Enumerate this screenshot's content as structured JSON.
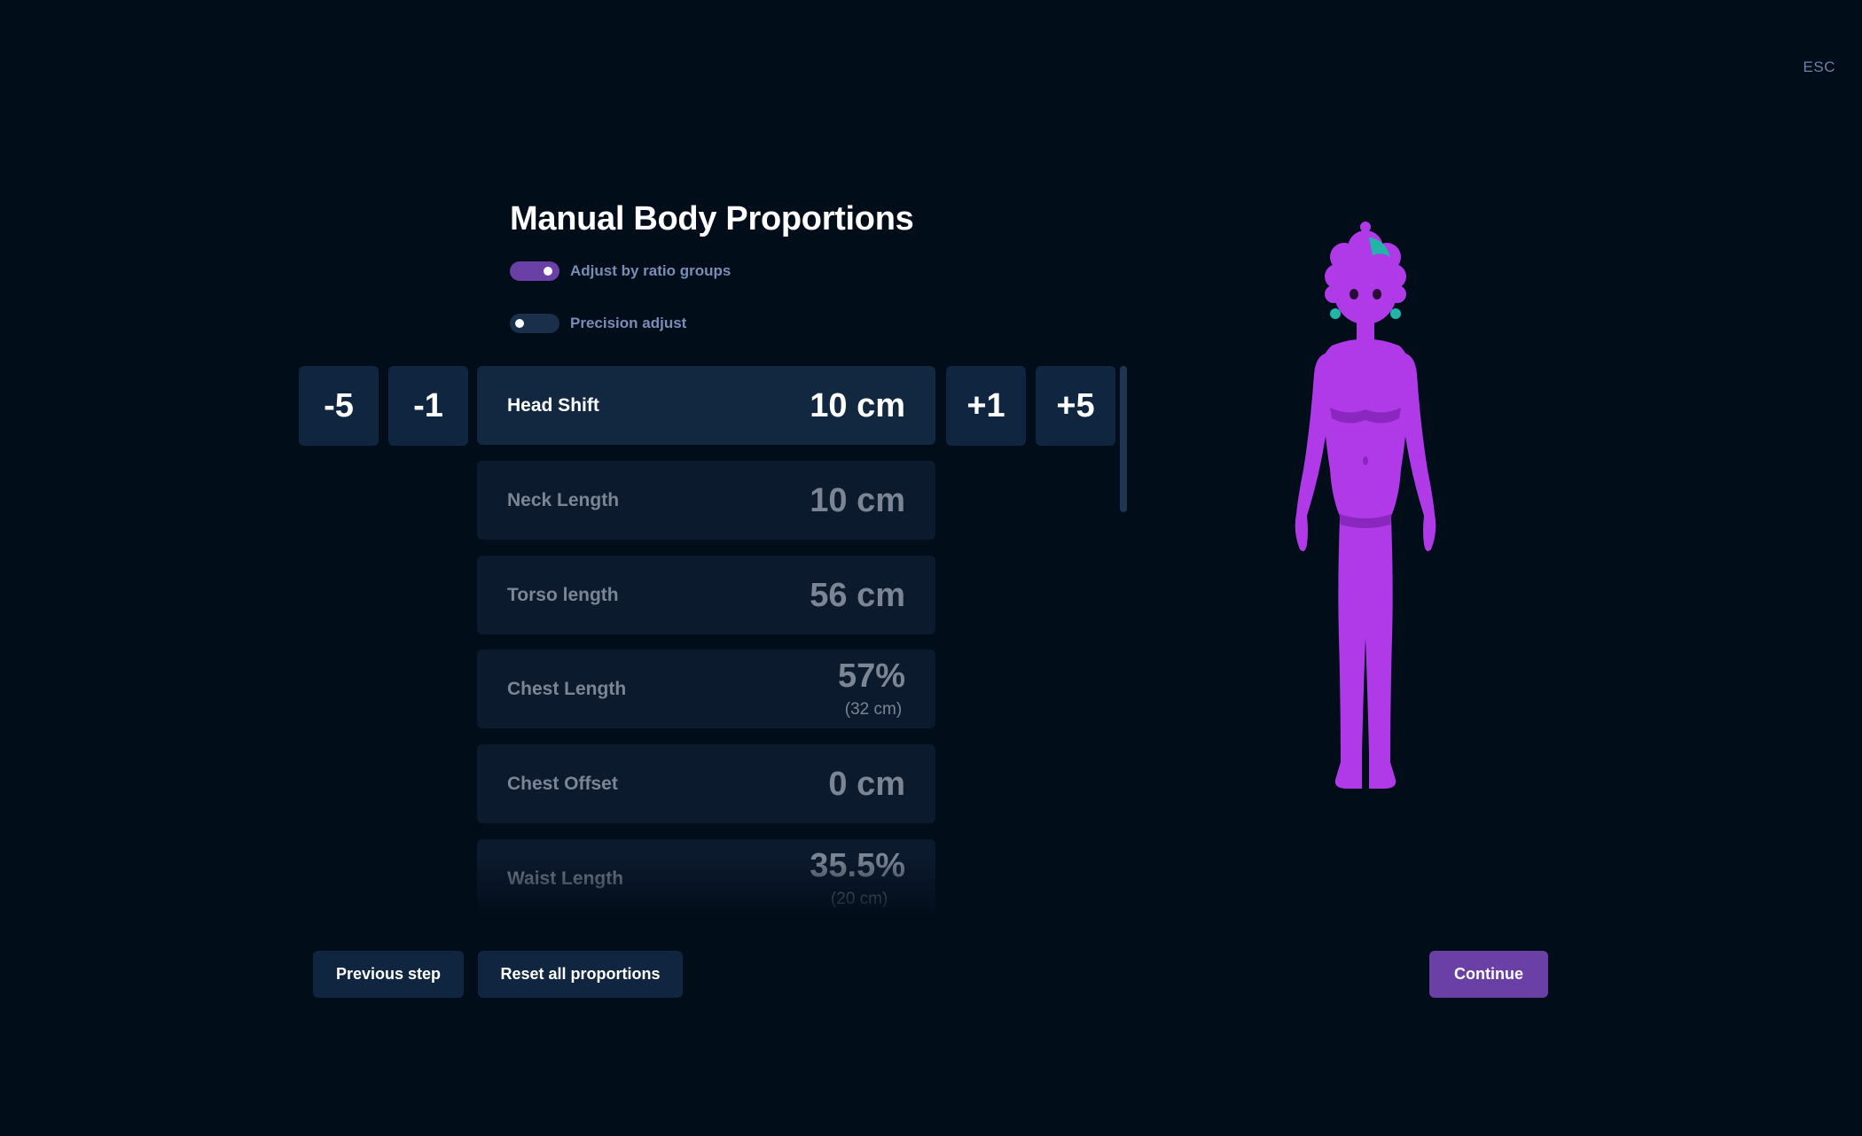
{
  "header": {
    "esc_label": "ESC"
  },
  "title": "Manual Body Proportions",
  "toggles": [
    {
      "label": "Adjust by ratio groups",
      "on": true
    },
    {
      "label": "Precision adjust",
      "on": false
    }
  ],
  "steppers": {
    "minus5": "-5",
    "minus1": "-1",
    "plus1": "+1",
    "plus5": "+5"
  },
  "proportions": [
    {
      "name": "Head Shift",
      "value": "10 cm",
      "active": true
    },
    {
      "name": "Neck Length",
      "value": "10 cm"
    },
    {
      "name": "Torso length",
      "value": "56 cm"
    },
    {
      "name": "Chest Length",
      "value": "57%",
      "sub": "(32 cm)"
    },
    {
      "name": "Chest Offset",
      "value": "0 cm"
    },
    {
      "name": "Waist Length",
      "value": "35.5%",
      "sub": "(20 cm)"
    }
  ],
  "buttons": {
    "previous": "Previous step",
    "reset": "Reset all proportions",
    "continue": "Continue"
  },
  "colors": {
    "background": "#020d1a",
    "panel": "#102640",
    "accent": "#6a3fa6",
    "avatar_body": "#b03ae8",
    "avatar_hair_accent": "#1fb5a7"
  }
}
